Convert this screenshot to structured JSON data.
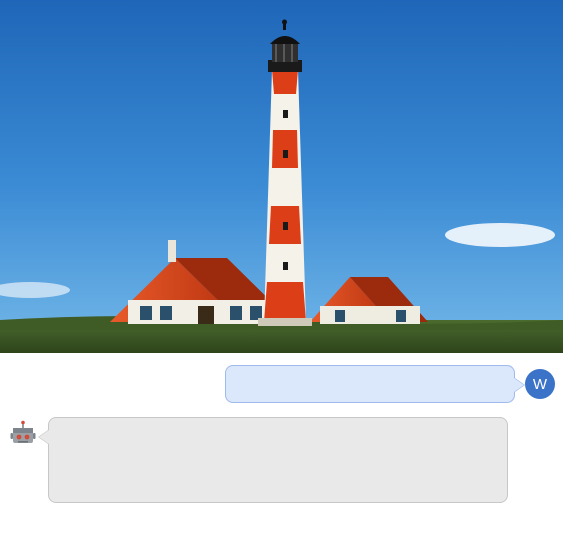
{
  "hero": {
    "alt": "lighthouse-photo"
  },
  "chat": {
    "user": {
      "avatar_letter": "W",
      "avatar_bg": "#3b73c9",
      "bubble_bg": "#dbe7fb",
      "bubble_border": "#9fb9ea",
      "message": ""
    },
    "bot": {
      "avatar_name": "robot-icon",
      "bubble_bg": "#e9e9e9",
      "bubble_border": "#c7c7c7",
      "message": ""
    }
  }
}
